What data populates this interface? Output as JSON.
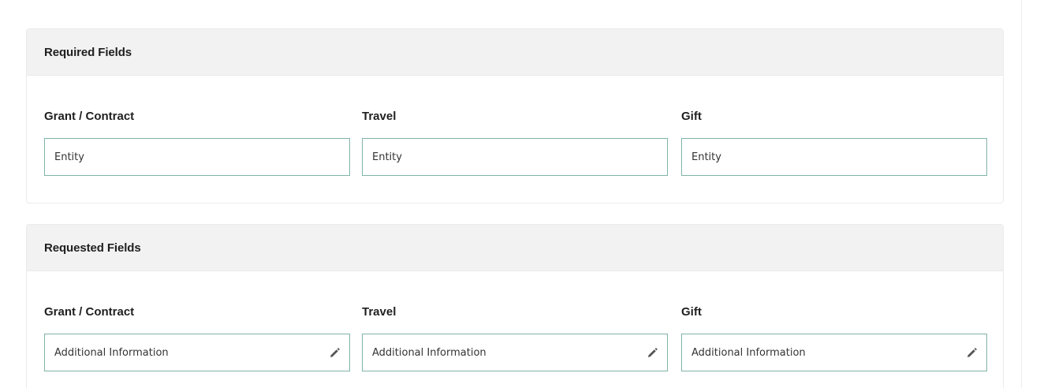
{
  "sections": [
    {
      "title": "Required Fields",
      "columns": [
        {
          "label": "Grant / Contract",
          "value": "Entity",
          "icon": "none"
        },
        {
          "label": "Travel",
          "value": "Entity",
          "icon": "none"
        },
        {
          "label": "Gift",
          "value": "Entity",
          "icon": "none"
        }
      ]
    },
    {
      "title": "Requested Fields",
      "columns": [
        {
          "label": "Grant / Contract",
          "value": "Additional Information",
          "icon": "pencil-icon"
        },
        {
          "label": "Travel",
          "value": "Additional Information",
          "icon": "pencil-icon"
        },
        {
          "label": "Gift",
          "value": "Additional Information",
          "icon": "pencil-icon"
        }
      ]
    }
  ],
  "colors": {
    "header_bg": "#f2f2f2",
    "field_border": "#7fb3a8",
    "text": "#1f1f1f"
  }
}
